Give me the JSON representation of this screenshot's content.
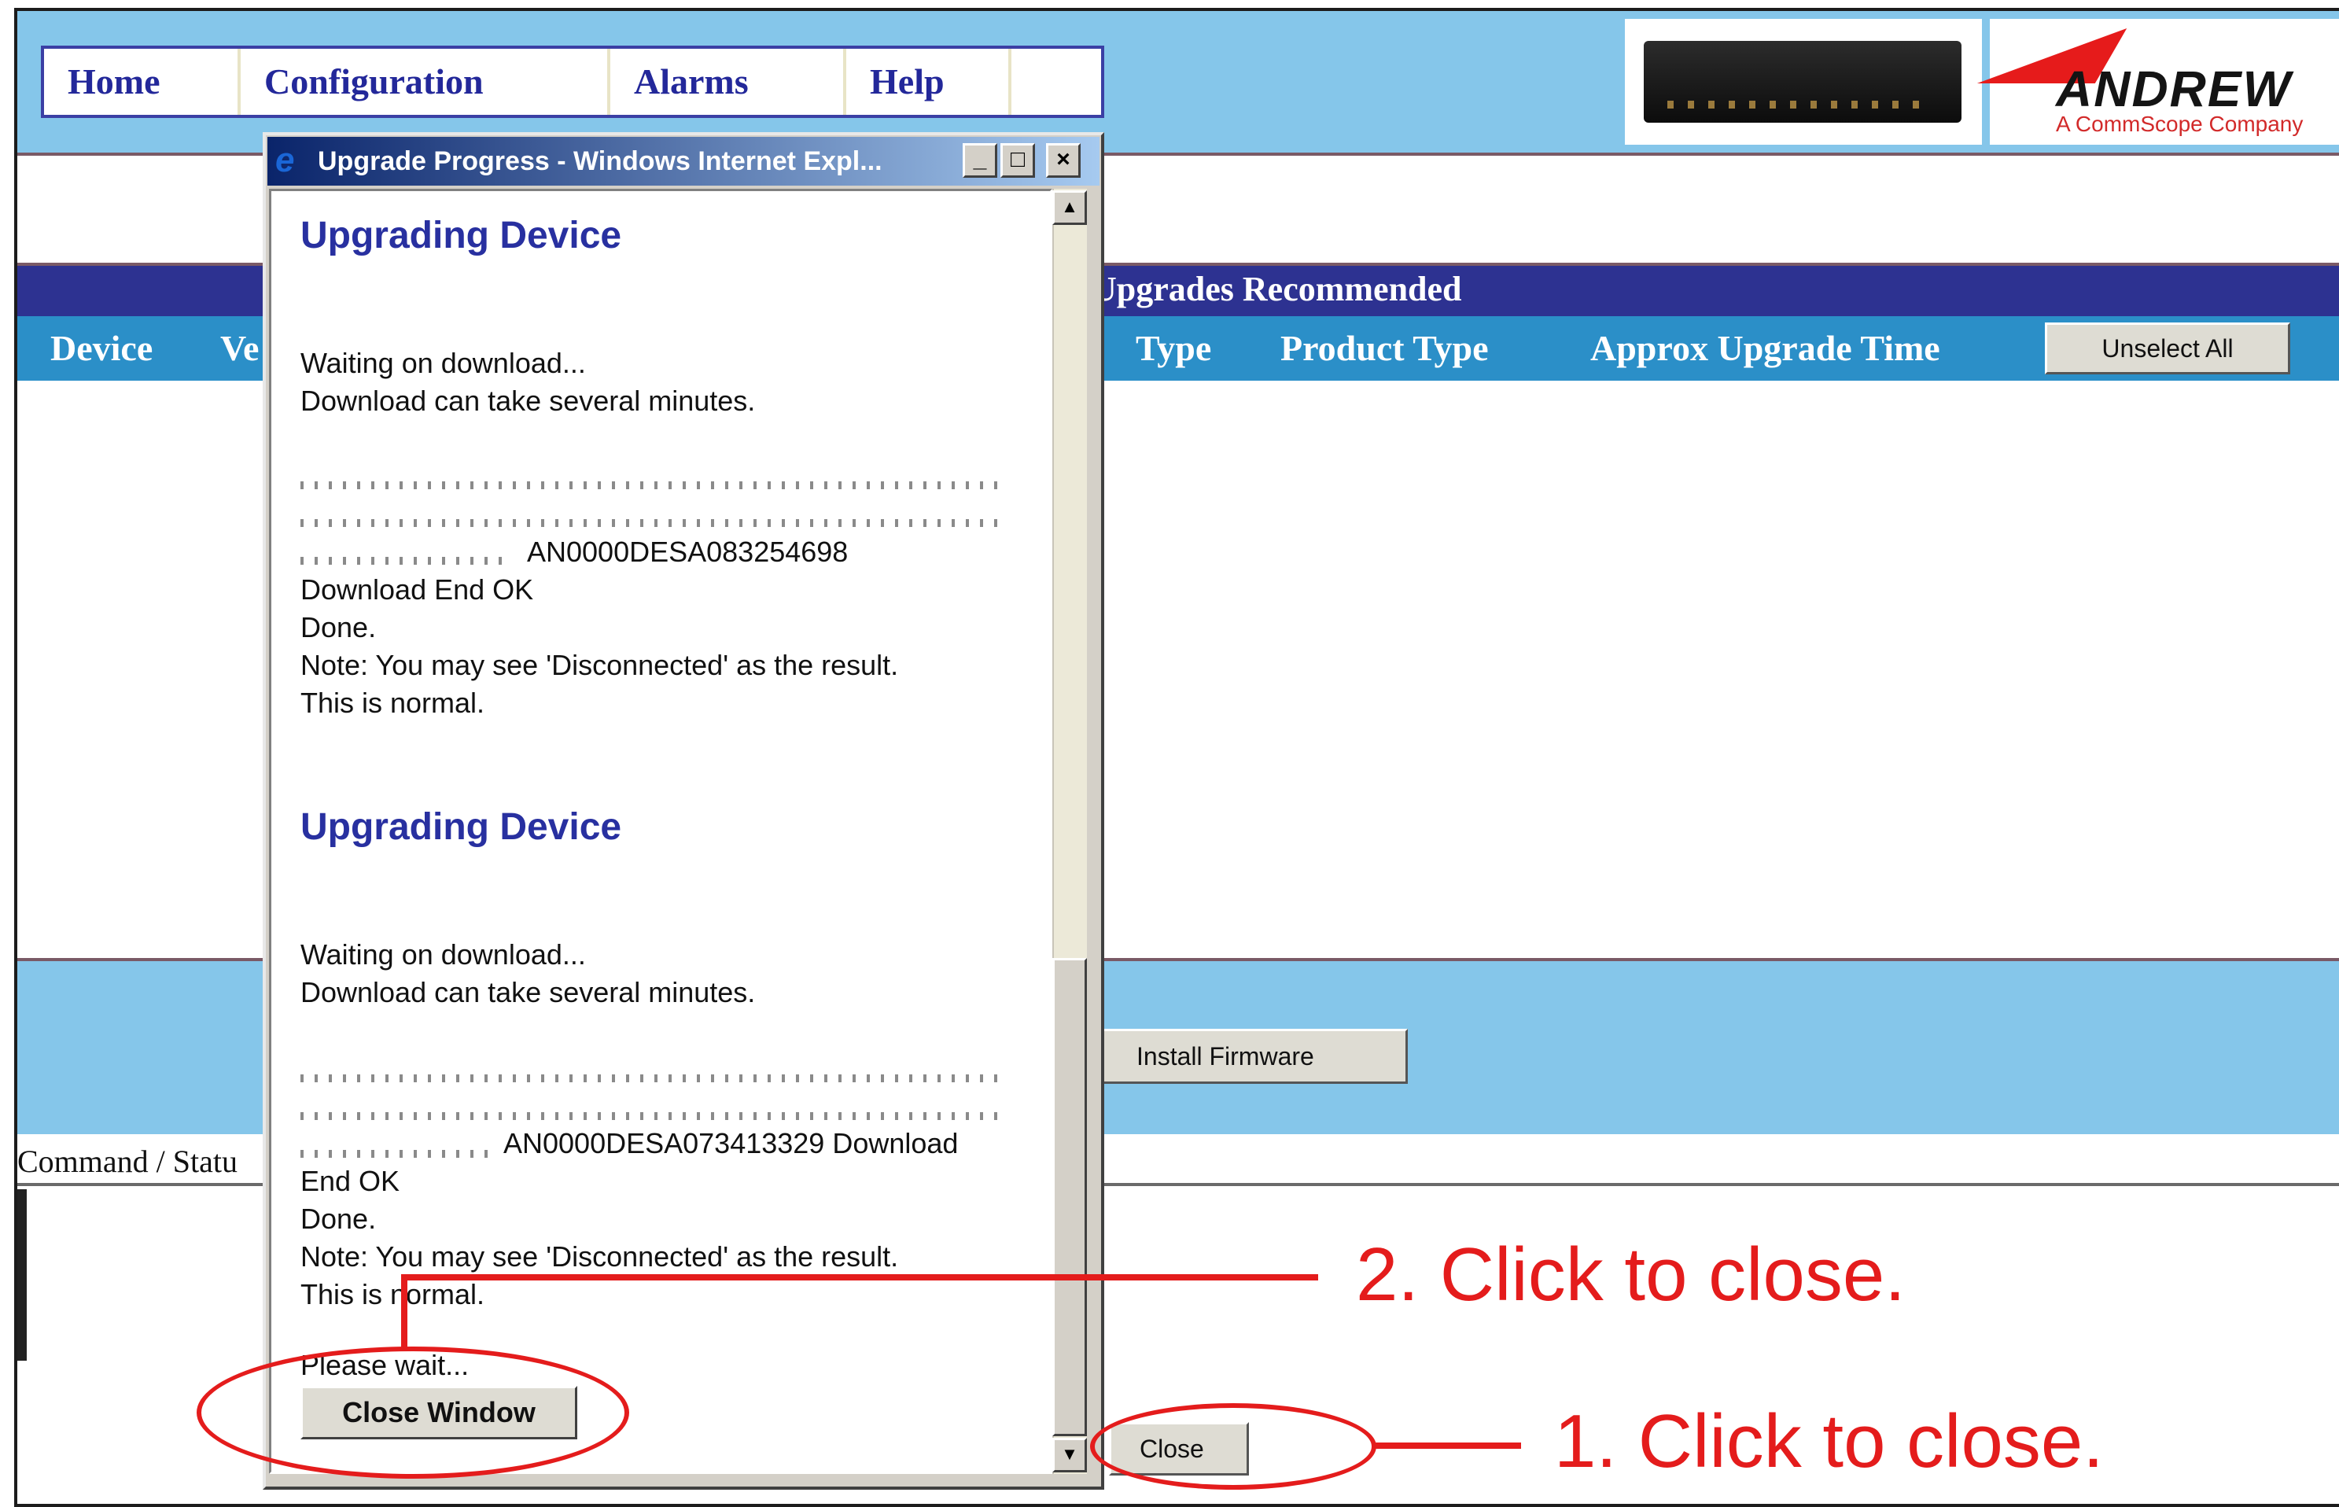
{
  "menu": [
    "Home",
    "Configuration",
    "Alarms",
    "Help"
  ],
  "logo": {
    "brand": "ANDREW",
    "tagline": "A CommScope Company"
  },
  "section_title": "Upgrades Recommended",
  "columns": [
    "Device",
    "Ve",
    "Type",
    "Product Type",
    "Approx Upgrade Time"
  ],
  "buttons": {
    "unselect_all": "Unselect All",
    "install_firmware": "Install Firmware",
    "close": "Close",
    "close_window": "Close Window"
  },
  "command_status_label": "Command / Statu",
  "popup": {
    "title": "Upgrade Progress - Windows Internet Expl...",
    "blocks": [
      {
        "heading": "Upgrading Device",
        "lines_top": [
          "Waiting on download...",
          "Download can take several minutes."
        ],
        "lines_bottom": [
          "AN0000DESA083254698",
          "Download End OK",
          "Done.",
          "Note: You may see 'Disconnected' as the result.",
          "This is normal."
        ]
      },
      {
        "heading": "Upgrading Device",
        "lines_top": [
          "Waiting on download...",
          "Download can take several minutes."
        ],
        "lines_bottom": [
          "AN0000DESA073413329 Download",
          "End OK",
          "Done.",
          "Note: You may see 'Disconnected' as the result.",
          "This is normal."
        ]
      }
    ],
    "please_wait": "Please wait..."
  },
  "annotations": {
    "step2": "2. Click to close.",
    "step1": "1. Click to close."
  },
  "colors": {
    "header_blue": "#85c6ea",
    "title_navy": "#2d3291",
    "column_blue": "#2b8fc8",
    "annotation_red": "#e41c1c",
    "heading_blue": "#2830a0"
  }
}
